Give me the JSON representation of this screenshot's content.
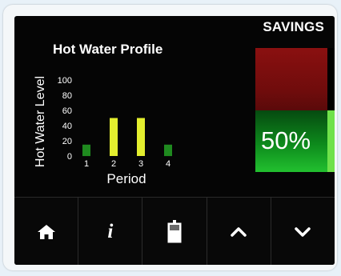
{
  "header": {
    "savings_label": "SAVINGS"
  },
  "savings": {
    "percent_label": "50%",
    "percent_value": 50,
    "fill_color": "#0d8a1c",
    "remaining_color": "#7a0e0e",
    "marker_color": "#6fe14a"
  },
  "chart_data": {
    "type": "bar",
    "title": "Hot Water Profile",
    "xlabel": "Period",
    "ylabel": "Hot Water Level",
    "categories": [
      "1",
      "2",
      "3",
      "4"
    ],
    "values": [
      15,
      50,
      50,
      15
    ],
    "colors": [
      "#1f8a1f",
      "#e3ee2e",
      "#e3ee2e",
      "#1f8a1f"
    ],
    "ylim": [
      0,
      100
    ],
    "yticks": [
      "100",
      "80",
      "60",
      "40",
      "20",
      "0"
    ],
    "grid": false
  },
  "nav": {
    "buttons": [
      {
        "name": "home-button",
        "icon": "home-icon"
      },
      {
        "name": "info-button",
        "icon": "info-icon",
        "glyph": "i"
      },
      {
        "name": "tank-button",
        "icon": "water-tank-icon"
      },
      {
        "name": "up-button",
        "icon": "chevron-up-icon"
      },
      {
        "name": "down-button",
        "icon": "chevron-down-icon"
      }
    ]
  }
}
